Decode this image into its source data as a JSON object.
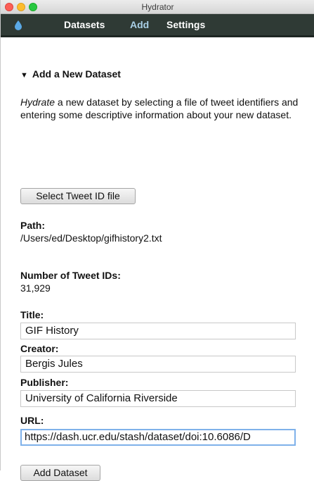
{
  "window": {
    "title": "Hydrator"
  },
  "nav": {
    "items": [
      {
        "label": "Datasets"
      },
      {
        "label": "Add"
      },
      {
        "label": "Settings"
      }
    ],
    "active": "Add",
    "active_color": "#a9cfe6",
    "bar_color": "#2f3a35"
  },
  "add_dataset": {
    "heading": "Add a New Dataset",
    "intro_emphasis": "Hydrate",
    "intro_rest": " a new dataset by selecting a file of tweet identifiers and entering some descriptive information about your new dataset.",
    "select_button": "Select Tweet ID file",
    "path_label": "Path:",
    "path_value": "/Users/ed/Desktop/gifhistory2.txt",
    "count_label": "Number of Tweet IDs:",
    "count_value": "31,929",
    "title_label": "Title:",
    "title_value": "GIF History",
    "creator_label": "Creator:",
    "creator_value": "Bergis Jules",
    "publisher_label": "Publisher:",
    "publisher_value": "University of California Riverside",
    "url_label": "URL:",
    "url_value": "https://dash.ucr.edu/stash/dataset/doi:10.6086/D",
    "add_button": "Add Dataset"
  }
}
